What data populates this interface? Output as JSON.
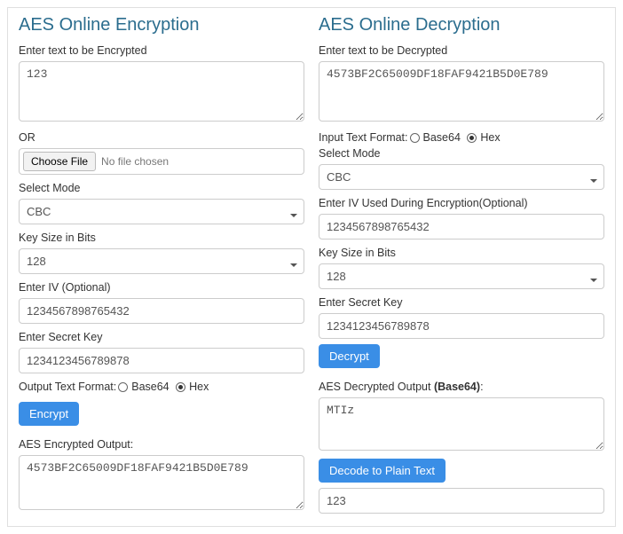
{
  "encryption": {
    "title": "AES Online Encryption",
    "input_label": "Enter text to be Encrypted",
    "input_value": "123",
    "or_label": "OR",
    "choose_file_btn": "Choose File",
    "no_file_text": "No file chosen",
    "mode_label": "Select Mode",
    "mode_value": "CBC",
    "keysize_label": "Key Size in Bits",
    "keysize_value": "128",
    "iv_label": "Enter IV (Optional)",
    "iv_value": "1234567898765432",
    "secret_label": "Enter Secret Key",
    "secret_value": "1234123456789878",
    "out_format_label": "Output Text Format: ",
    "radio_base64": "Base64",
    "radio_hex": "Hex",
    "encrypt_btn": "Encrypt",
    "output_label": "AES Encrypted Output:",
    "output_value": "4573BF2C65009DF18FAF9421B5D0E789"
  },
  "decryption": {
    "title": "AES Online Decryption",
    "input_label": "Enter text to be Decrypted",
    "input_value": "4573BF2C65009DF18FAF9421B5D0E789",
    "in_format_label": "Input Text Format: ",
    "radio_base64": "Base64",
    "radio_hex": "Hex",
    "mode_label": "Select Mode",
    "mode_value": "CBC",
    "iv_label": "Enter IV Used During Encryption(Optional)",
    "iv_value": "1234567898765432",
    "keysize_label": "Key Size in Bits",
    "keysize_value": "128",
    "secret_label": "Enter Secret Key",
    "secret_value": "1234123456789878",
    "decrypt_btn": "Decrypt",
    "output_label_prefix": "AES Decrypted Output ",
    "output_label_bold": "(Base64)",
    "output_label_suffix": ":",
    "output_value": "MTIz",
    "decode_btn": "Decode to Plain Text",
    "plain_value": "123"
  }
}
